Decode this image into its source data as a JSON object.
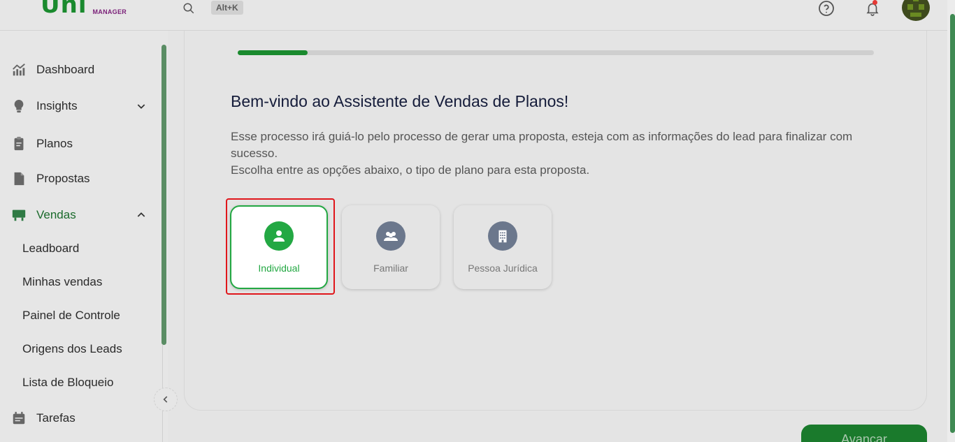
{
  "header": {
    "logo_text": "Uni",
    "logo_subtext": "MANAGER",
    "search_shortcut": "Alt+K"
  },
  "sidebar": {
    "items": [
      {
        "label": "Dashboard",
        "icon": "chart-icon"
      },
      {
        "label": "Insights",
        "icon": "lightbulb-icon",
        "expandable": true,
        "expanded": false
      },
      {
        "label": "Planos",
        "icon": "clipboard-icon"
      },
      {
        "label": "Propostas",
        "icon": "document-icon"
      },
      {
        "label": "Vendas",
        "icon": "storefront-icon",
        "expandable": true,
        "expanded": true,
        "active": true
      },
      {
        "label": "Tarefas",
        "icon": "calendar-icon"
      }
    ],
    "vendas_subitems": [
      "Leadboard",
      "Minhas vendas",
      "Painel de Controle",
      "Origens dos Leads",
      "Lista de Bloqueio"
    ]
  },
  "wizard": {
    "progress": 0.11,
    "title": "Bem-vindo ao Assistente de Vendas de Planos!",
    "description_line1": "Esse processo irá guiá-lo pelo processo de gerar uma proposta, esteja com as informações do lead para finalizar com sucesso.",
    "description_line2": "Escolha entre as opções abaixo, o tipo de plano para esta proposta.",
    "options": [
      {
        "label": "Individual",
        "icon": "person-icon",
        "selected": true
      },
      {
        "label": "Familiar",
        "icon": "group-icon",
        "selected": false
      },
      {
        "label": "Pessoa Jurídica",
        "icon": "building-icon",
        "selected": false
      }
    ],
    "next_label": "Avançar"
  },
  "colors": {
    "accent": "#23a843",
    "brand_dark": "#1a8a2e",
    "highlight": "#e0161b",
    "muted_icon": "#6b778c"
  }
}
